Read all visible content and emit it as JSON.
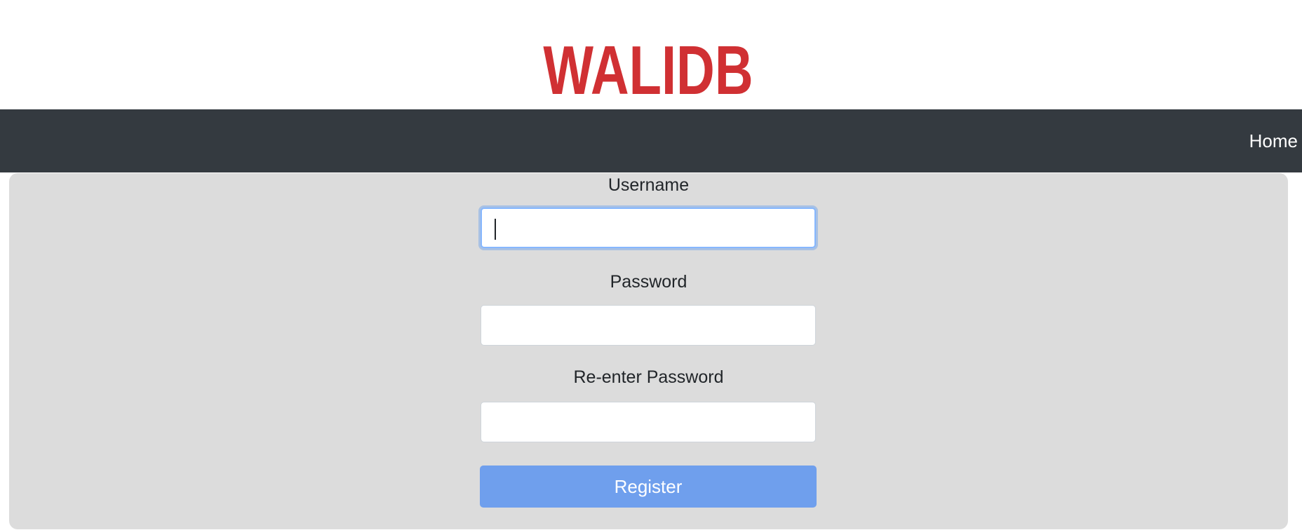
{
  "brand": {
    "logo_text": "WALIDB",
    "logo_color": "#d03033"
  },
  "navbar": {
    "background": "#343a40",
    "home_label": "Home"
  },
  "form": {
    "username_label": "Username",
    "username_value": "",
    "password_label": "Password",
    "password_value": "",
    "reenter_password_label": "Re-enter Password",
    "reenter_password_value": "",
    "register_label": "Register",
    "button_color": "#6f9fed"
  }
}
